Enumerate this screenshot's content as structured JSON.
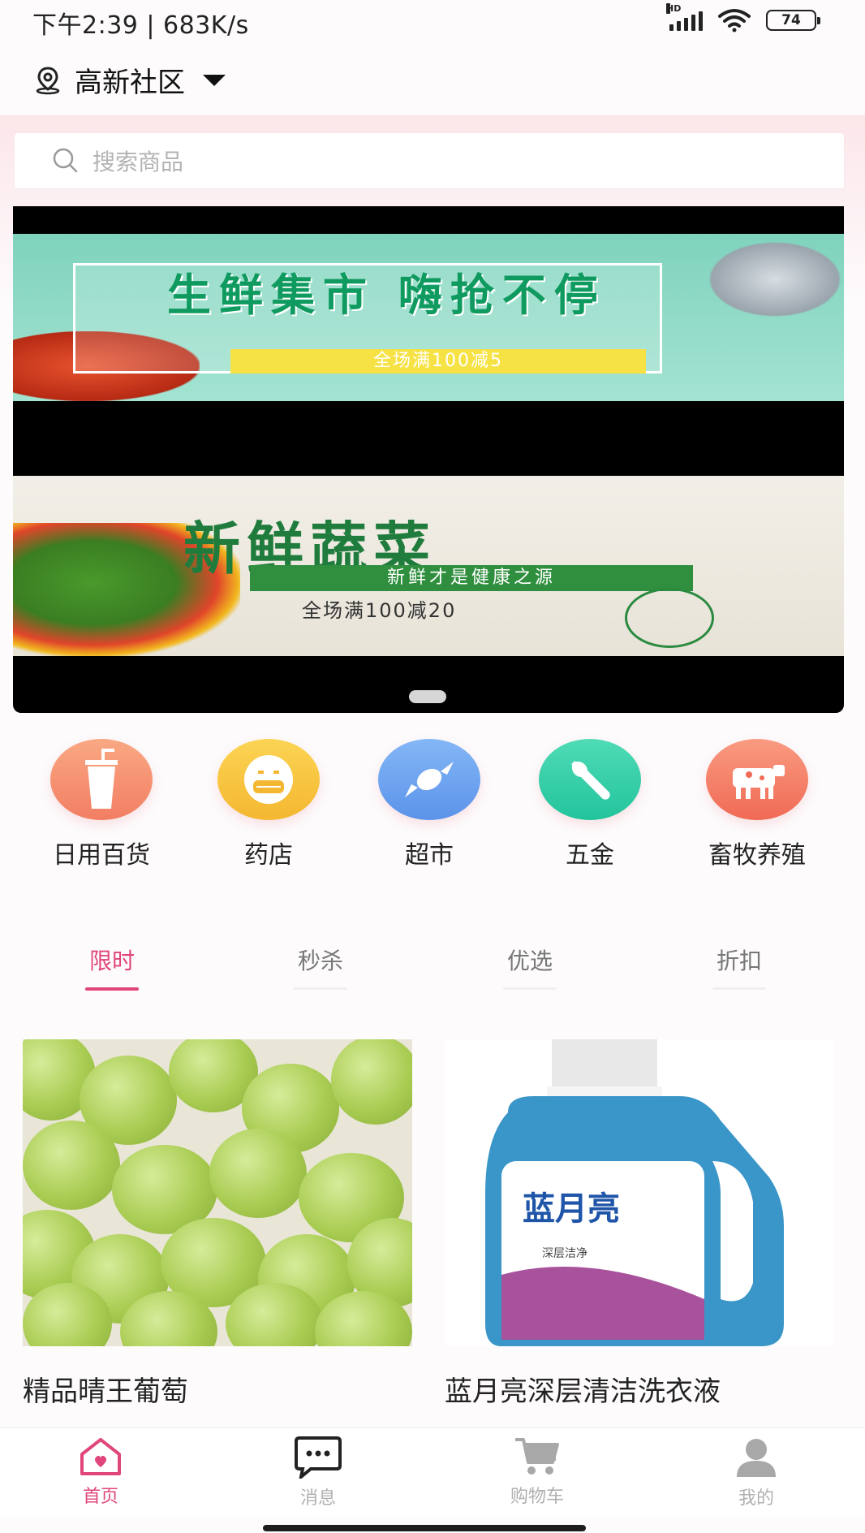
{
  "status_bar": {
    "time": "下午2:39 | 683K/s",
    "battery": "74",
    "hd": "HD"
  },
  "location": {
    "name": "高新社区"
  },
  "search": {
    "placeholder": "搜索商品"
  },
  "banners": [
    {
      "title": "生鲜集市 嗨抢不停",
      "promo": "全场满100减5",
      "accent": "#0f9a60"
    },
    {
      "title": "新鲜蔬菜",
      "subtitle": "新鲜才是健康之源",
      "promo": "全场满100减20",
      "accent": "#1f7c3c"
    }
  ],
  "categories": [
    {
      "label": "日用百货",
      "icon": "cup-icon",
      "color": "#f6906c"
    },
    {
      "label": "药店",
      "icon": "mask-face-icon",
      "color": "#f8c43c"
    },
    {
      "label": "超市",
      "icon": "candy-icon",
      "color": "#6aa4f0"
    },
    {
      "label": "五金",
      "icon": "wrench-icon",
      "color": "#34d0aa"
    },
    {
      "label": "畜牧养殖",
      "icon": "cow-icon",
      "color": "#f6806a"
    }
  ],
  "tabs": [
    {
      "label": "限时",
      "active": true
    },
    {
      "label": "秒杀",
      "active": false
    },
    {
      "label": "优选",
      "active": false
    },
    {
      "label": "折扣",
      "active": false
    }
  ],
  "products": [
    {
      "name": "精品晴王葡萄",
      "image": "green-grapes"
    },
    {
      "name": "蓝月亮深层清洁洗衣液",
      "image": "detergent-bottle",
      "brand": "蓝月亮",
      "label_line": "深层洁净"
    }
  ],
  "bottom_nav": [
    {
      "label": "首页",
      "icon": "home-icon",
      "active": true
    },
    {
      "label": "消息",
      "icon": "message-icon",
      "active": false
    },
    {
      "label": "购物车",
      "icon": "cart-icon",
      "active": false
    },
    {
      "label": "我的",
      "icon": "user-icon",
      "active": false
    }
  ],
  "colors": {
    "accent": "#e0457b",
    "muted": "#b0b0b0"
  }
}
